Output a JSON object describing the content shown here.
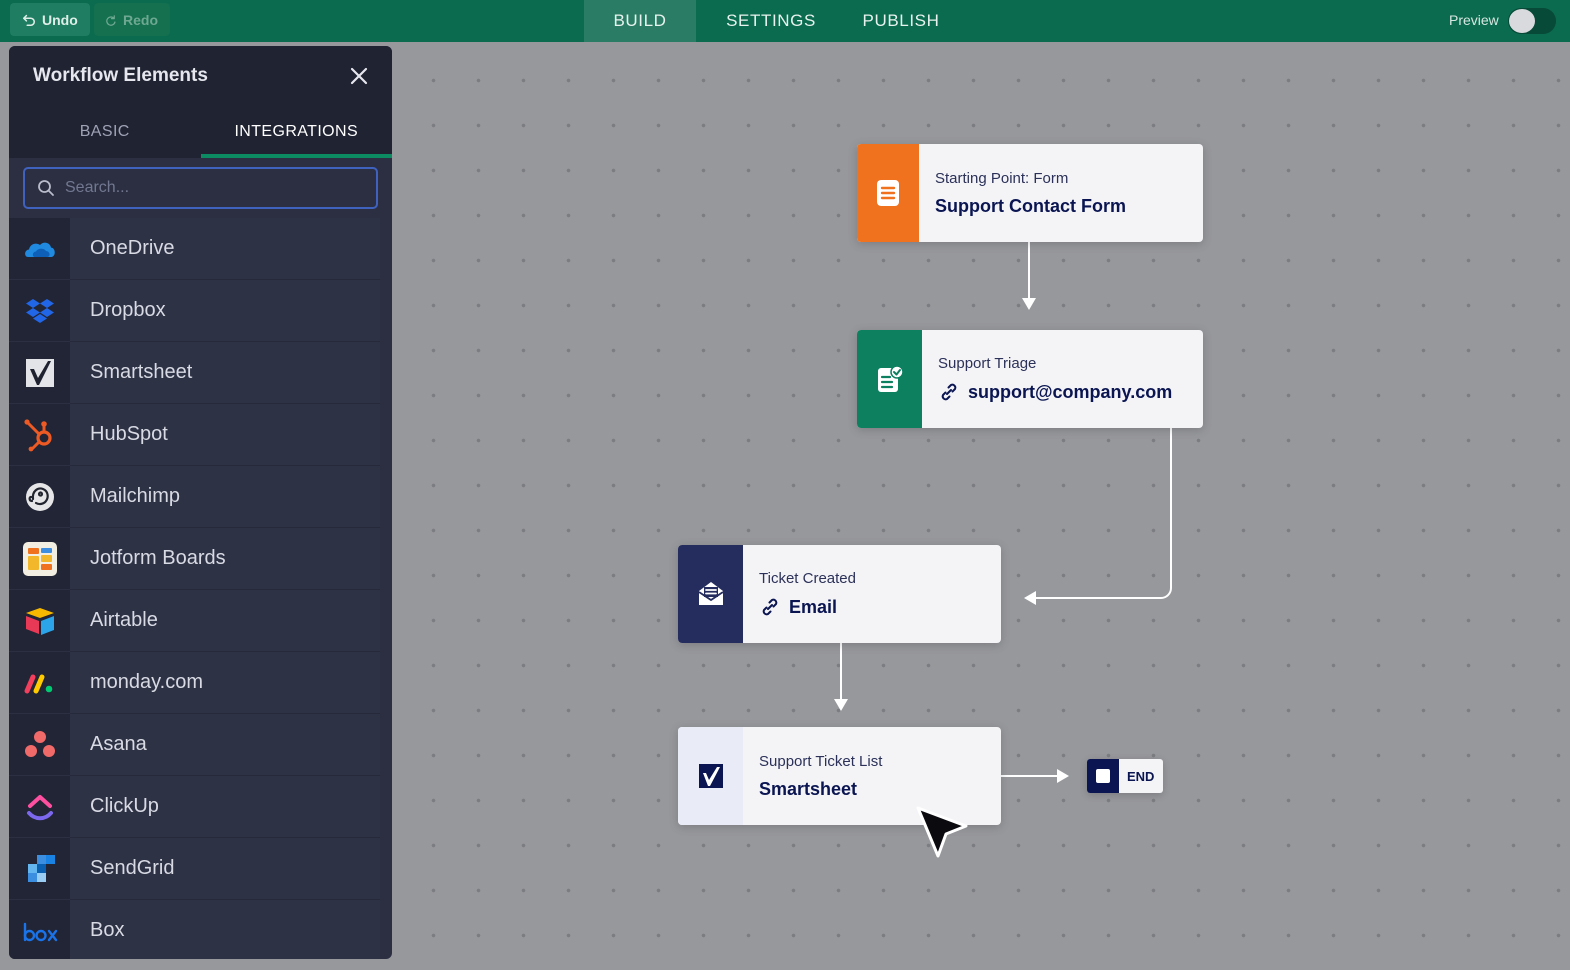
{
  "topbar": {
    "undo_label": "Undo",
    "redo_label": "Redo",
    "tabs": [
      {
        "label": "BUILD",
        "active": true
      },
      {
        "label": "SETTINGS",
        "active": false
      },
      {
        "label": "PUBLISH",
        "active": false
      }
    ],
    "preview_label": "Preview",
    "preview_on": false
  },
  "panel": {
    "title": "Workflow Elements",
    "tabs": [
      {
        "label": "BASIC",
        "active": false
      },
      {
        "label": "INTEGRATIONS",
        "active": true
      }
    ],
    "search_placeholder": "Search...",
    "integrations": [
      {
        "label": "OneDrive",
        "icon": "onedrive-icon"
      },
      {
        "label": "Dropbox",
        "icon": "dropbox-icon"
      },
      {
        "label": "Smartsheet",
        "icon": "smartsheet-icon"
      },
      {
        "label": "HubSpot",
        "icon": "hubspot-icon"
      },
      {
        "label": "Mailchimp",
        "icon": "mailchimp-icon"
      },
      {
        "label": "Jotform Boards",
        "icon": "jotform-boards-icon"
      },
      {
        "label": "Airtable",
        "icon": "airtable-icon"
      },
      {
        "label": "monday.com",
        "icon": "monday-icon"
      },
      {
        "label": "Asana",
        "icon": "asana-icon"
      },
      {
        "label": "ClickUp",
        "icon": "clickup-icon"
      },
      {
        "label": "SendGrid",
        "icon": "sendgrid-icon"
      },
      {
        "label": "Box",
        "icon": "box-icon"
      }
    ]
  },
  "canvas": {
    "nodes": {
      "form": {
        "subtitle": "Starting Point: Form",
        "title": "Support Contact Form",
        "color": "#f0721f"
      },
      "triage": {
        "subtitle": "Support Triage",
        "title": "support@company.com",
        "color": "#0d8060"
      },
      "ticket": {
        "subtitle": "Ticket Created",
        "title": "Email",
        "color": "#252d5e"
      },
      "list": {
        "subtitle": "Support Ticket List",
        "title": "Smartsheet",
        "color": "#e9ebf6"
      }
    },
    "end_label": "END"
  },
  "colors": {
    "topbar": "#0a6b4f",
    "panel": "#2b2f41",
    "accent": "#0c8b63",
    "search_border": "#3f62bf"
  }
}
